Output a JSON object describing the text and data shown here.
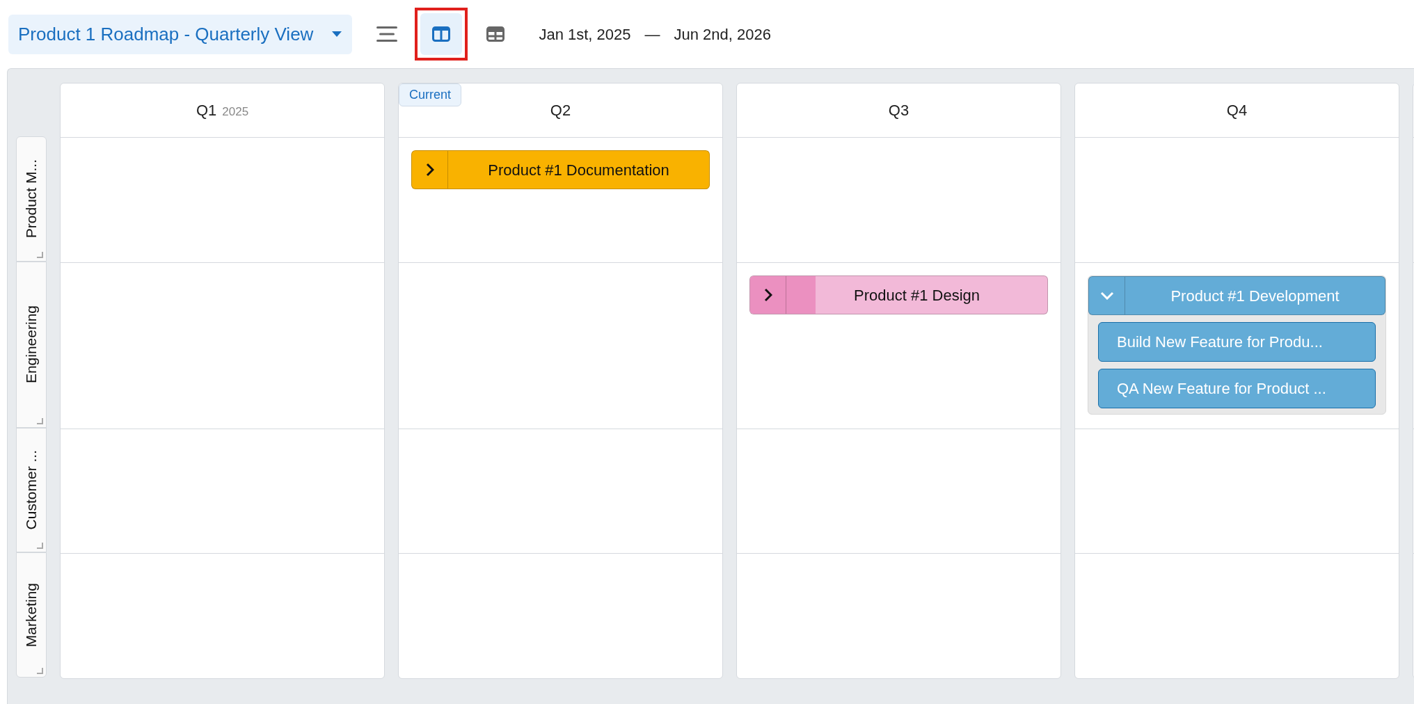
{
  "roadmap_selector": {
    "label": "Product 1 Roadmap - Quarterly View"
  },
  "views": [
    {
      "kind": "list",
      "selected": false
    },
    {
      "kind": "columns",
      "selected": true,
      "highlighted": true
    },
    {
      "kind": "grid",
      "selected": false
    }
  ],
  "date_range": {
    "start": "Jan 1st, 2025",
    "separator": "—",
    "end": "Jun 2nd, 2026"
  },
  "quarters": [
    {
      "label": "Q1",
      "year": "2025",
      "current": false
    },
    {
      "label": "Q2",
      "current": true,
      "current_label": "Current"
    },
    {
      "label": "Q3",
      "current": false
    },
    {
      "label": "Q4",
      "current": false
    },
    {
      "current": false
    }
  ],
  "lanes": [
    {
      "label": "Product M...",
      "cells": [
        {},
        {
          "items": [
            {
              "title": "Product #1 Documentation",
              "color": "#f9b200",
              "expanded": false
            }
          ]
        },
        {},
        {},
        {}
      ]
    },
    {
      "label": "Engineering",
      "cells": [
        {},
        {},
        {
          "items": [
            {
              "title": "Product #1 Design",
              "color": "#f2b9d8",
              "level": 0.22,
              "expanded": false
            }
          ]
        },
        {
          "items": [
            {
              "title": "Product #1 Development",
              "color": "#63acd7",
              "expanded": true,
              "children": [
                {
                  "title": "Build New Feature for Produ..."
                },
                {
                  "title": "QA New Feature for Product ..."
                }
              ]
            }
          ]
        },
        {}
      ]
    },
    {
      "label": "Customer ...",
      "cells": [
        {},
        {},
        {},
        {},
        {}
      ]
    },
    {
      "label": "Marketing",
      "cells": [
        {},
        {},
        {},
        {},
        {}
      ]
    }
  ]
}
